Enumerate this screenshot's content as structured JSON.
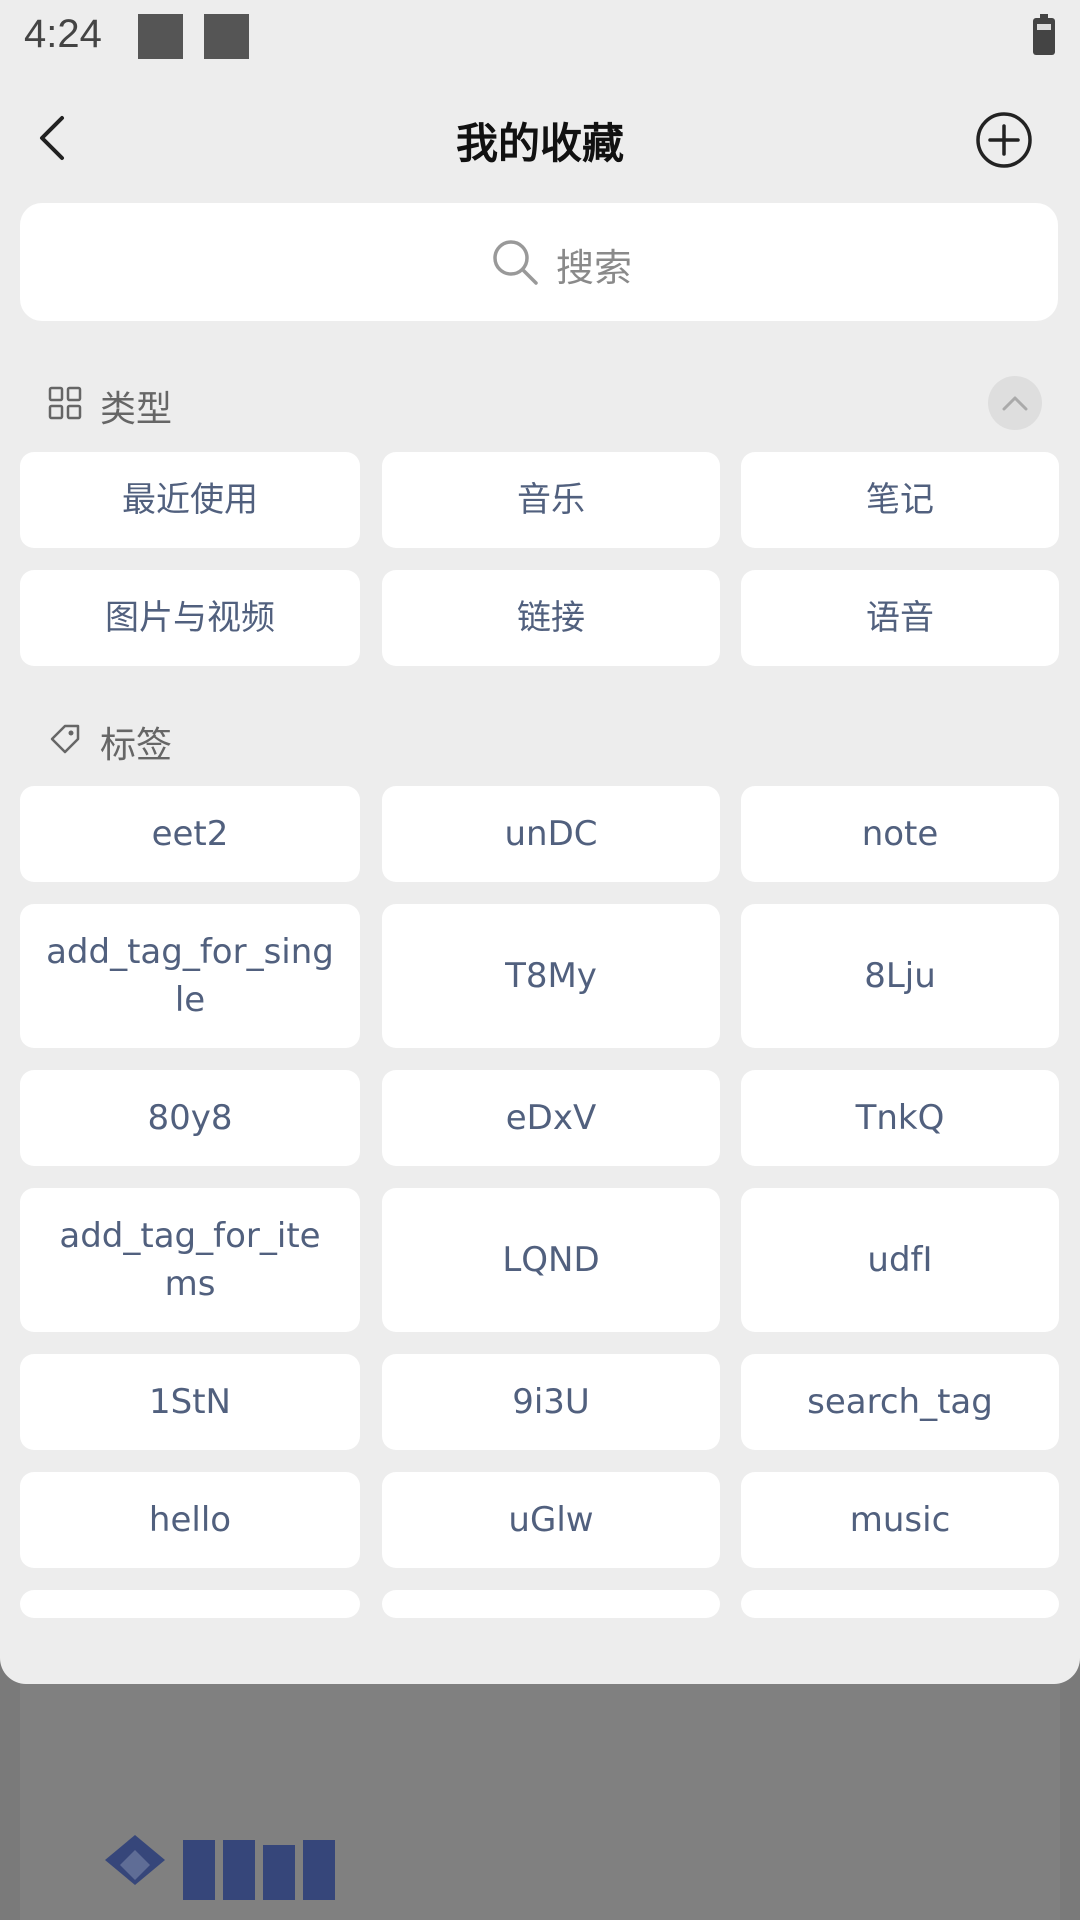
{
  "status_bar": {
    "time": "4:24"
  },
  "header": {
    "title": "我的收藏",
    "back_icon": "chevron-left-icon",
    "add_icon": "plus-circle-icon"
  },
  "search": {
    "placeholder": "搜索",
    "icon": "search-icon"
  },
  "types_section": {
    "label": "类型",
    "icon": "grid-icon",
    "collapse_icon": "chevron-up-icon",
    "items": [
      "最近使用",
      "音乐",
      "笔记",
      "图片与视频",
      "链接",
      "语音"
    ]
  },
  "tags_section": {
    "label": "标签",
    "icon": "tag-icon",
    "items": [
      "eet2",
      "unDC",
      "note",
      "add_tag_for_single",
      "T8My",
      "8Lju",
      "80y8",
      "eDxV",
      "TnkQ",
      "add_tag_for_items",
      "LQND",
      "udfI",
      "1StN",
      "9i3U",
      "search_tag",
      "hello",
      "uGlw",
      "music"
    ]
  },
  "colors": {
    "sheet_bg": "#ededed",
    "chip_bg": "#ffffff",
    "chip_text": "#51607e",
    "overlay": "#7a7a7a"
  }
}
